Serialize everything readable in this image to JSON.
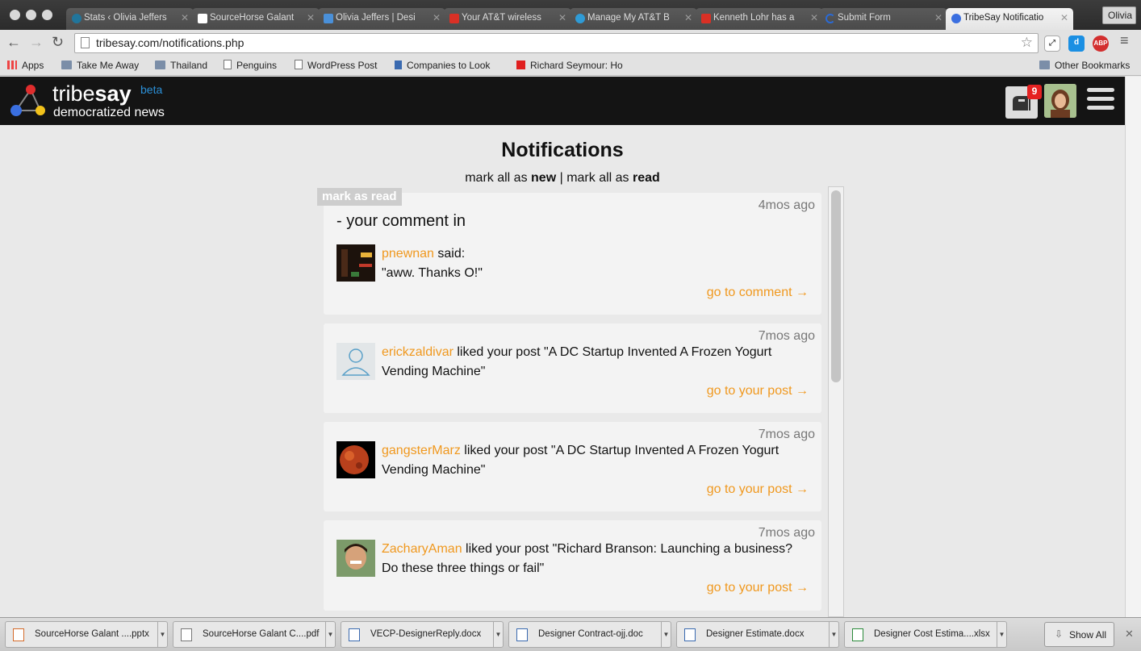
{
  "browser": {
    "tabs": [
      {
        "label": "Stats ‹ Olivia Jeffers",
        "icon": "wordpress-icon",
        "color": "#21759b"
      },
      {
        "label": "SourceHorse Galant",
        "icon": "document-icon",
        "color": "#ffffff"
      },
      {
        "label": "Olivia Jeffers | Desi",
        "icon": "grid-icon",
        "color": "#4a90d9"
      },
      {
        "label": "Your AT&T wireless",
        "icon": "gmail-icon",
        "color": "#d93025"
      },
      {
        "label": "Manage My AT&T B",
        "icon": "att-icon",
        "color": "#2f9bd6"
      },
      {
        "label": "Kenneth Lohr has a",
        "icon": "gmail-icon",
        "color": "#d93025"
      },
      {
        "label": "Submit Form",
        "icon": "moon-icon",
        "color": "#2a6ad6"
      },
      {
        "label": "TribeSay Notificatio",
        "icon": "tribesay-icon",
        "color": "#3b6fe0"
      }
    ],
    "user_name": "Olivia",
    "url": "tribesay.com/notifications.php",
    "bookmarks": [
      {
        "label": "Apps",
        "icon": "apps-grid-icon"
      },
      {
        "label": "Take Me Away",
        "icon": "folder-icon"
      },
      {
        "label": "Thailand",
        "icon": "folder-icon"
      },
      {
        "label": "Penguins",
        "icon": "document-icon"
      },
      {
        "label": "WordPress Post",
        "icon": "document-icon"
      },
      {
        "label": "Companies to Look",
        "icon": "bookmark-icon"
      },
      {
        "label": "Richard Seymour: Ho",
        "icon": "t-logo-icon"
      }
    ],
    "other_bookmarks": "Other Bookmarks"
  },
  "site": {
    "brand": "tribe",
    "brand_bold": "say",
    "beta": "beta",
    "tagline": "democratized news",
    "notification_count": "9"
  },
  "page": {
    "title": "Notifications",
    "mark_all_prefix": "mark all as ",
    "mark_new": "new",
    "separator": " | ",
    "mark_all_prefix2": "mark all as ",
    "mark_read": "read",
    "mark_as_read_chip": "mark as read"
  },
  "notifications": [
    {
      "time": "4mos ago",
      "heading": "- your comment in",
      "user": "pnewnan",
      "action": " said:",
      "quote": "\"aww. Thanks O!\"",
      "link": "go to comment →"
    },
    {
      "time": "7mos ago",
      "user": "erickzaldivar",
      "action": " liked your post \"A DC Startup Invented A Frozen Yogurt Vending Machine\"",
      "link": "go to your post →"
    },
    {
      "time": "7mos ago",
      "user": "gangsterMarz",
      "action": " liked your post \"A DC Startup Invented A Frozen Yogurt Vending Machine\"",
      "link": "go to your post →"
    },
    {
      "time": "7mos ago",
      "user": "ZacharyAman",
      "action": " liked your post \"Richard Branson: Launching a business? Do these three things or fail\"",
      "link": "go to your post →"
    }
  ],
  "downloads": [
    {
      "name": "SourceHorse Galant ....pptx"
    },
    {
      "name": "SourceHorse Galant C....pdf"
    },
    {
      "name": "VECP-DesignerReply.docx"
    },
    {
      "name": "Designer Contract-ojj.doc"
    },
    {
      "name": "Designer Estimate.docx"
    },
    {
      "name": "Designer Cost Estima....xlsx"
    }
  ],
  "show_all": "Show All",
  "colors": {
    "accent": "#f0981e",
    "header_bg": "#141414",
    "badge": "#e52222"
  }
}
